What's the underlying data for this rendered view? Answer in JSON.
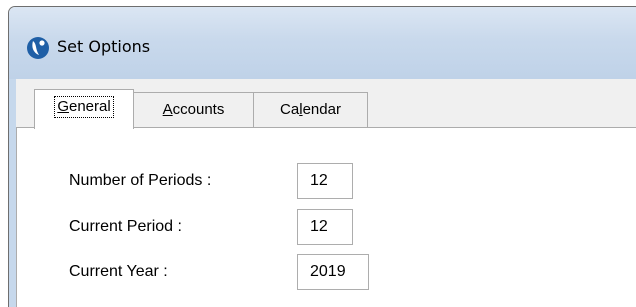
{
  "window": {
    "title": "Set Options"
  },
  "tabs": [
    {
      "label_before": "",
      "mnemonic": "G",
      "label_after": "eneral"
    },
    {
      "label_before": "",
      "mnemonic": "A",
      "label_after": "ccounts"
    },
    {
      "label_before": "Ca",
      "mnemonic": "l",
      "label_after": "endar"
    }
  ],
  "active_tab": "General",
  "general": {
    "number_of_periods": {
      "label": "Number of Periods :",
      "value": "12"
    },
    "current_period": {
      "label": "Current Period :",
      "value": "12"
    },
    "current_year": {
      "label": "Current Year :",
      "value": "2019"
    }
  },
  "colors": {
    "titlebar": "#c9d9ec",
    "icon_blue": "#1f5fa6",
    "panel_bg": "#ffffff",
    "window_bg": "#f0f0f0"
  },
  "icons": {
    "app": "app-logo-icon"
  }
}
